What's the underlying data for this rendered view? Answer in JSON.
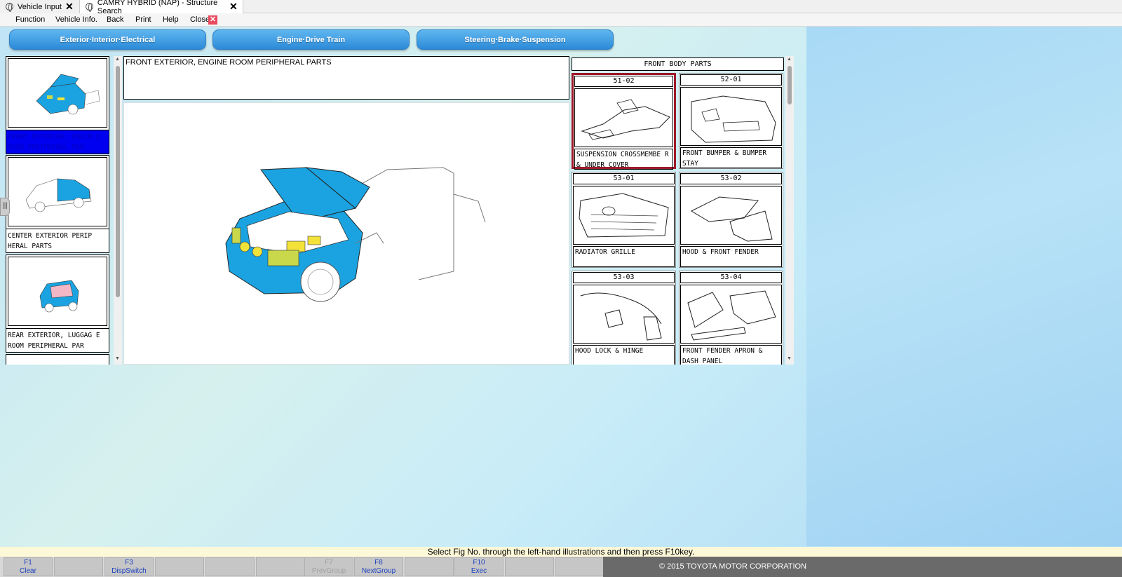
{
  "tabs": [
    {
      "label": "Vehicle Input"
    },
    {
      "label": "CAMRY HYBRID (NAP) - Structure Search"
    }
  ],
  "menu": {
    "items": [
      "Function",
      "Vehicle Info.",
      "Back",
      "Print",
      "Help",
      "Close"
    ]
  },
  "categories": [
    "Exterior·Interior·Electrical",
    "Engine·Drive Train",
    "Steering·Brake·Suspension"
  ],
  "thumbnails": [
    {
      "label": "FRONT EXTERIOR, ENGIN E ROOM PERIPHERAL PAR",
      "selected": true
    },
    {
      "label": "CENTER EXTERIOR PERIP HERAL PARTS",
      "selected": false
    },
    {
      "label": "REAR EXTERIOR, LUGGAG E ROOM PERIPHERAL PAR",
      "selected": false
    }
  ],
  "center": {
    "description": "FRONT EXTERIOR, ENGINE ROOM PERIPHERAL PARTS"
  },
  "group": {
    "title": "FRONT BODY PARTS",
    "parts": [
      {
        "code": "51-02",
        "label": "SUSPENSION CROSSMEMBE R & UNDER COVER",
        "selected": true
      },
      {
        "code": "52-01",
        "label": "FRONT BUMPER & BUMPER STAY",
        "selected": false
      },
      {
        "code": "53-01",
        "label": "RADIATOR GRILLE",
        "selected": false
      },
      {
        "code": "53-02",
        "label": "HOOD & FRONT FENDER",
        "selected": false
      },
      {
        "code": "53-03",
        "label": "HOOD LOCK & HINGE",
        "selected": false
      },
      {
        "code": "53-04",
        "label": "FRONT FENDER APRON & DASH PANEL",
        "selected": false
      }
    ]
  },
  "status": {
    "message": "Select Fig No. through the left-hand illustrations and then press F10key.",
    "copyright": "© 2015 TOYOTA MOTOR CORPORATION"
  },
  "fkeys": [
    {
      "key": "F1",
      "label": "Clear",
      "enabled": true
    },
    {
      "key": "",
      "label": "",
      "enabled": false
    },
    {
      "key": "F3",
      "label": "DispSwitch",
      "enabled": true
    },
    {
      "key": "",
      "label": "",
      "enabled": false
    },
    {
      "key": "",
      "label": "",
      "enabled": false
    },
    {
      "key": "",
      "label": "",
      "enabled": false
    },
    {
      "key": "F7",
      "label": "PrevGroup",
      "enabled": false
    },
    {
      "key": "F8",
      "label": "NextGroup",
      "enabled": true
    },
    {
      "key": "",
      "label": "",
      "enabled": false
    },
    {
      "key": "F10",
      "label": "Exec",
      "enabled": true
    },
    {
      "key": "",
      "label": "",
      "enabled": false
    },
    {
      "key": "",
      "label": "",
      "enabled": false
    }
  ],
  "colors": {
    "accent_blue": "#2c8ad8",
    "selected_part_border": "#a0182a",
    "selected_thumb_bg": "#0000f0",
    "car_blue": "#1aa3e0"
  }
}
